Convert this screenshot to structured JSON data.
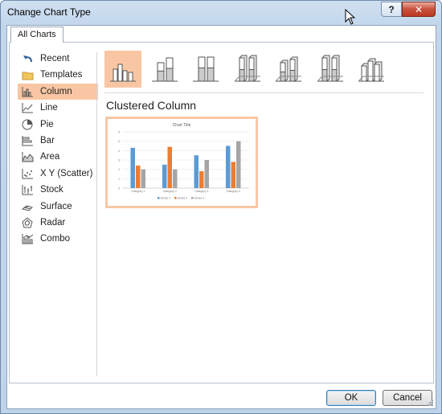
{
  "window": {
    "title": "Change Chart Type",
    "help_label": "?",
    "close_label": "✕"
  },
  "tabs": [
    {
      "label": "All Charts"
    }
  ],
  "sidebar": {
    "items": [
      {
        "label": "Recent",
        "icon": "undo-arrow-icon"
      },
      {
        "label": "Templates",
        "icon": "folder-icon"
      },
      {
        "label": "Column",
        "icon": "column-chart-icon",
        "selected": true
      },
      {
        "label": "Line",
        "icon": "line-chart-icon"
      },
      {
        "label": "Pie",
        "icon": "pie-chart-icon"
      },
      {
        "label": "Bar",
        "icon": "bar-chart-icon"
      },
      {
        "label": "Area",
        "icon": "area-chart-icon"
      },
      {
        "label": "X Y (Scatter)",
        "icon": "scatter-chart-icon"
      },
      {
        "label": "Stock",
        "icon": "stock-chart-icon"
      },
      {
        "label": "Surface",
        "icon": "surface-chart-icon"
      },
      {
        "label": "Radar",
        "icon": "radar-chart-icon"
      },
      {
        "label": "Combo",
        "icon": "combo-chart-icon"
      }
    ]
  },
  "subtypes": {
    "selected_title": "Clustered Column",
    "items": [
      {
        "name": "clustered-column",
        "selected": true
      },
      {
        "name": "stacked-column"
      },
      {
        "name": "100-stacked-column"
      },
      {
        "name": "3d-clustered-column"
      },
      {
        "name": "3d-stacked-column"
      },
      {
        "name": "3d-100-stacked-column"
      },
      {
        "name": "3d-column"
      }
    ]
  },
  "preview": {
    "chart_data": {
      "type": "bar",
      "title": "Chart Title",
      "categories": [
        "Category 1",
        "Category 2",
        "Category 3",
        "Category 4"
      ],
      "ylim": [
        0,
        6
      ],
      "yticks": [
        "0",
        "1",
        "2",
        "3",
        "4",
        "5",
        "6"
      ],
      "series": [
        {
          "name": "Series 1",
          "values": [
            4.3,
            2.5,
            3.5,
            4.5
          ],
          "color": "#5b9bd5"
        },
        {
          "name": "Series 2",
          "values": [
            2.4,
            4.4,
            1.8,
            2.8
          ],
          "color": "#ed7d31"
        },
        {
          "name": "Series 3",
          "values": [
            2.0,
            2.0,
            3.0,
            5.0
          ],
          "color": "#a5a5a5"
        }
      ],
      "legend": "bottom",
      "grid": true
    }
  },
  "buttons": {
    "ok": "OK",
    "cancel": "Cancel"
  },
  "colors": {
    "selection": "#f9c6a4",
    "titlebar": "#c3d7ec"
  }
}
